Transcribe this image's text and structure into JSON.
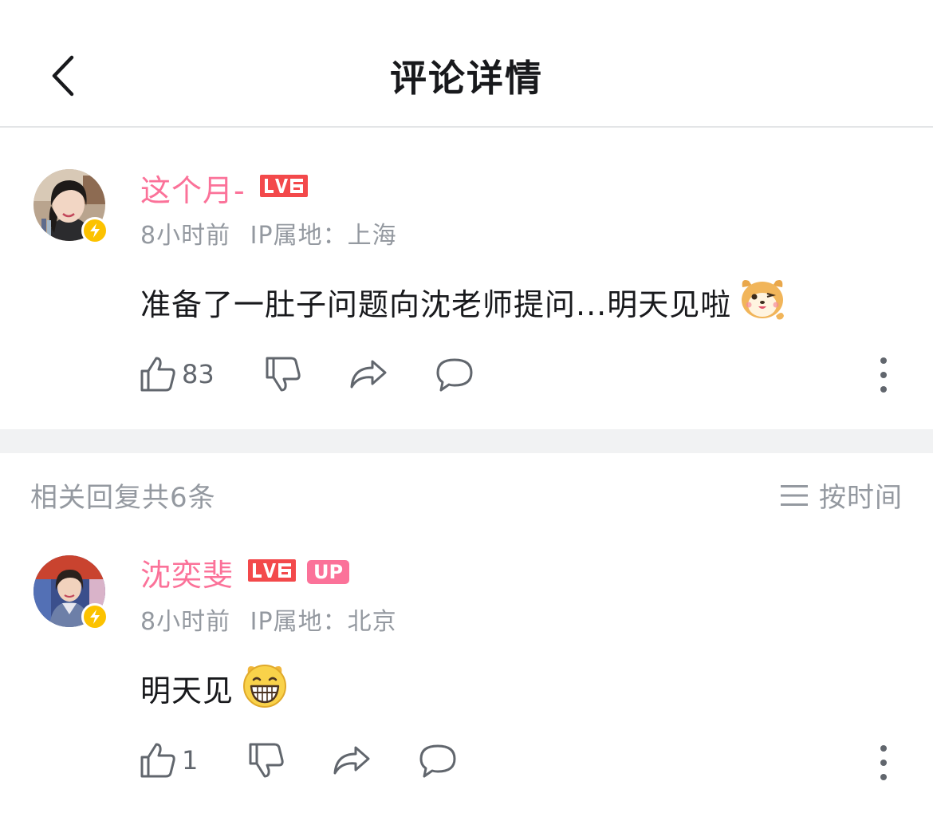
{
  "header": {
    "title": "评论详情"
  },
  "main_comment": {
    "username": "这个月-",
    "level": "LV6",
    "time": "8小时前",
    "ip": "IP属地：上海",
    "text": "准备了一肚子问题向沈老师提问...明天见啦",
    "emoji": "hamster-wink-emoji",
    "like_count": "83"
  },
  "replies_header": {
    "count_text": "相关回复共6条",
    "sort_label": "按时间"
  },
  "reply": {
    "username": "沈奕斐",
    "level": "LV6",
    "up_tag": "UP",
    "time": "8小时前",
    "ip": "IP属地：北京",
    "text": "明天见",
    "emoji": "grin-emoji",
    "like_count": "1"
  },
  "colors": {
    "accent_pink": "#fb7299",
    "level_red": "#f3494b",
    "verify_yellow": "#fcc200",
    "secondary_text": "#9499a0"
  }
}
